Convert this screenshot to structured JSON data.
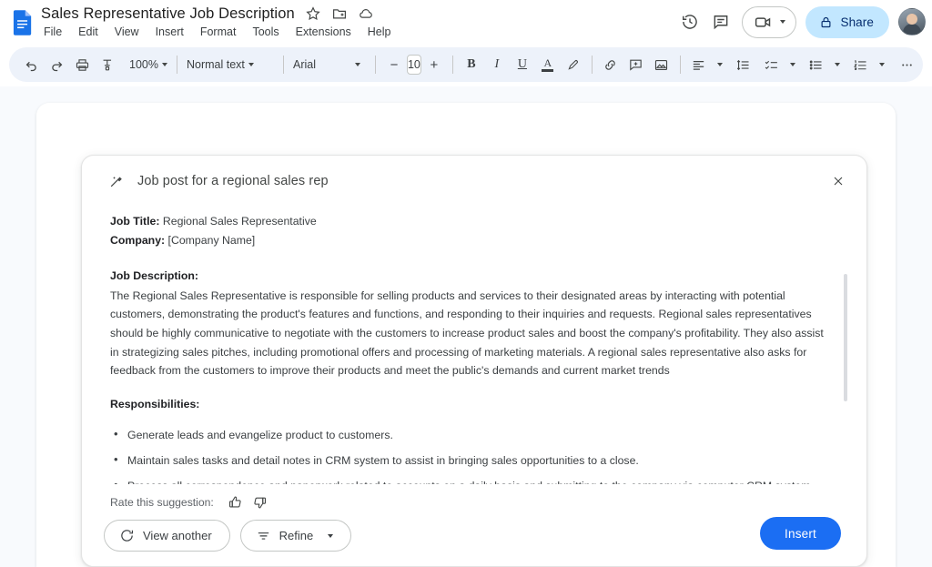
{
  "app": {
    "doc_title": "Sales Representative Job Description",
    "menus": [
      "File",
      "Edit",
      "View",
      "Insert",
      "Format",
      "Tools",
      "Extensions",
      "Help"
    ],
    "title_icons": [
      "star-icon",
      "move-to-folder-icon",
      "cloud-saved-icon"
    ],
    "right_icons": [
      "version-history-icon",
      "comment-icon"
    ],
    "meet_label": "",
    "share_label": "Share",
    "accent_blue": "#1b6ef3",
    "share_bg": "#c2e7ff"
  },
  "toolbar": {
    "undo": "undo-icon",
    "redo": "redo-icon",
    "print": "print-icon",
    "spellcheck": "spellcheck-icon",
    "zoom_value": "100%",
    "style_value": "Normal text",
    "font_value": "Arial",
    "font_decrease": "−",
    "font_size_value": "10",
    "font_increase": "+",
    "bold": "B",
    "italic": "I",
    "underline": "U",
    "text_color": "A",
    "highlight": "highlight-pen-icon",
    "link": "link-icon",
    "comment": "add-comment-icon",
    "image": "insert-image-icon",
    "align": "align-left-icon",
    "line_spacing": "line-spacing-icon",
    "checklist": "checklist-icon",
    "bulleted_list": "bulleted-list-icon",
    "numbered_list": "numbered-list-icon",
    "more": "more-options-icon",
    "editing_mode": "spelling-grammar-icon",
    "pen_mode": "editing-mode-pen-icon",
    "collapse": "collapse-toolbar-icon"
  },
  "card": {
    "icon": "magic-wand-icon",
    "title": "Job post for a regional sales rep",
    "close_icon": "close-icon",
    "fields": [
      {
        "label": "Job Title:",
        "value": " Regional Sales Representative"
      },
      {
        "label": "Company:",
        "value": " [Company Name]"
      }
    ],
    "description_heading": "Job Description:",
    "description_body": "The Regional Sales Representative is responsible for selling products and services to their designated areas by interacting with potential customers, demonstrating the product's features and functions, and responding to their inquiries and requests. Regional sales representatives should be highly communicative to negotiate with the customers to increase product sales and boost the company's profitability. They also assist in strategizing sales pitches, including promotional offers and processing of marketing materials. A regional sales representative also asks for feedback from the customers to improve their products and meet the public's demands and current market trends",
    "responsibilities_heading": "Responsibilities:",
    "responsibilities": [
      "Generate leads and evangelize product to customers.",
      "Maintain sales tasks and detail notes in CRM system to assist in bringing sales opportunities to a close.",
      "Process all correspondence and paperwork related to accounts on a daily basis and submitting to the company via computer CRM system."
    ],
    "rate_label": "Rate this suggestion:",
    "thumb_up_icon": "thumb-up-icon",
    "thumb_down_icon": "thumb-down-icon",
    "view_another_label": "View another",
    "view_another_icon": "refresh-icon",
    "refine_label": "Refine",
    "refine_icon": "tune-icon",
    "insert_label": "Insert"
  }
}
